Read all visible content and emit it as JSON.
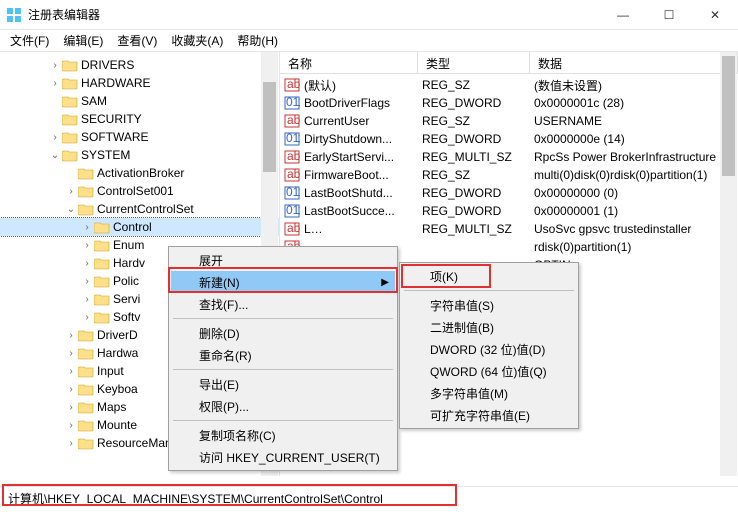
{
  "title": "注册表编辑器",
  "winbtns": {
    "min": "—",
    "max": "☐",
    "close": "✕"
  },
  "menu": [
    "文件(F)",
    "编辑(E)",
    "查看(V)",
    "收藏夹(A)",
    "帮助(H)"
  ],
  "tree": [
    {
      "d": 3,
      "e": ">",
      "t": "DRIVERS"
    },
    {
      "d": 3,
      "e": ">",
      "t": "HARDWARE"
    },
    {
      "d": 3,
      "e": "",
      "t": "SAM"
    },
    {
      "d": 3,
      "e": "",
      "t": "SECURITY"
    },
    {
      "d": 3,
      "e": ">",
      "t": "SOFTWARE"
    },
    {
      "d": 3,
      "e": "v",
      "t": "SYSTEM"
    },
    {
      "d": 4,
      "e": "",
      "t": "ActivationBroker"
    },
    {
      "d": 4,
      "e": ">",
      "t": "ControlSet001"
    },
    {
      "d": 4,
      "e": "v",
      "t": "CurrentControlSet"
    },
    {
      "d": 5,
      "e": ">",
      "t": "Control",
      "sel": true
    },
    {
      "d": 5,
      "e": ">",
      "t": "Enum"
    },
    {
      "d": 5,
      "e": ">",
      "t": "Hardv"
    },
    {
      "d": 5,
      "e": ">",
      "t": "Polic"
    },
    {
      "d": 5,
      "e": ">",
      "t": "Servi"
    },
    {
      "d": 5,
      "e": ">",
      "t": "Softv"
    },
    {
      "d": 4,
      "e": ">",
      "t": "DriverD"
    },
    {
      "d": 4,
      "e": ">",
      "t": "Hardwa"
    },
    {
      "d": 4,
      "e": ">",
      "t": "Input"
    },
    {
      "d": 4,
      "e": ">",
      "t": "Keyboa"
    },
    {
      "d": 4,
      "e": ">",
      "t": "Maps"
    },
    {
      "d": 4,
      "e": ">",
      "t": "Mounte"
    },
    {
      "d": 4,
      "e": ">",
      "t": "ResourceManager"
    }
  ],
  "cols": {
    "name": "名称",
    "type": "类型",
    "data": "数据"
  },
  "rows": [
    {
      "i": "s",
      "n": "(默认)",
      "t": "REG_SZ",
      "d": "(数值未设置)"
    },
    {
      "i": "b",
      "n": "BootDriverFlags",
      "t": "REG_DWORD",
      "d": "0x0000001c (28)"
    },
    {
      "i": "s",
      "n": "CurrentUser",
      "t": "REG_SZ",
      "d": "USERNAME"
    },
    {
      "i": "b",
      "n": "DirtyShutdown...",
      "t": "REG_DWORD",
      "d": "0x0000000e (14)"
    },
    {
      "i": "s",
      "n": "EarlyStartServi...",
      "t": "REG_MULTI_SZ",
      "d": "RpcSs Power BrokerInfrastructure S"
    },
    {
      "i": "s",
      "n": "FirmwareBoot...",
      "t": "REG_SZ",
      "d": "multi(0)disk(0)rdisk(0)partition(1)"
    },
    {
      "i": "b",
      "n": "LastBootShutd...",
      "t": "REG_DWORD",
      "d": "0x00000000 (0)"
    },
    {
      "i": "b",
      "n": "LastBootSucce...",
      "t": "REG_DWORD",
      "d": "0x00000001 (1)"
    },
    {
      "i": "s",
      "n": "L…",
      "t": "REG_MULTI_SZ",
      "d": "UsoSvc gpsvc trustedinstaller"
    },
    {
      "i": "s",
      "n": "",
      "t": "",
      "d": "rdisk(0)partition(1)"
    },
    {
      "i": "s",
      "n": "",
      "t": "",
      "d": "OPTIN"
    }
  ],
  "ctx1": [
    {
      "t": "展开"
    },
    {
      "t": "新建(N)",
      "hot": true,
      "sub": true
    },
    {
      "t": "查找(F)..."
    },
    {
      "sep": true
    },
    {
      "t": "删除(D)"
    },
    {
      "t": "重命名(R)"
    },
    {
      "sep": true
    },
    {
      "t": "导出(E)"
    },
    {
      "t": "权限(P)..."
    },
    {
      "sep": true
    },
    {
      "t": "复制项名称(C)"
    },
    {
      "t": "访问 HKEY_CURRENT_USER(T)"
    }
  ],
  "ctx2": [
    {
      "t": "项(K)"
    },
    {
      "sep": true
    },
    {
      "t": "字符串值(S)"
    },
    {
      "t": "二进制值(B)"
    },
    {
      "t": "DWORD (32 位)值(D)"
    },
    {
      "t": "QWORD (64 位)值(Q)"
    },
    {
      "t": "多字符串值(M)"
    },
    {
      "t": "可扩充字符串值(E)"
    }
  ],
  "status": "计算机\\HKEY_LOCAL_MACHINE\\SYSTEM\\CurrentControlSet\\Control"
}
